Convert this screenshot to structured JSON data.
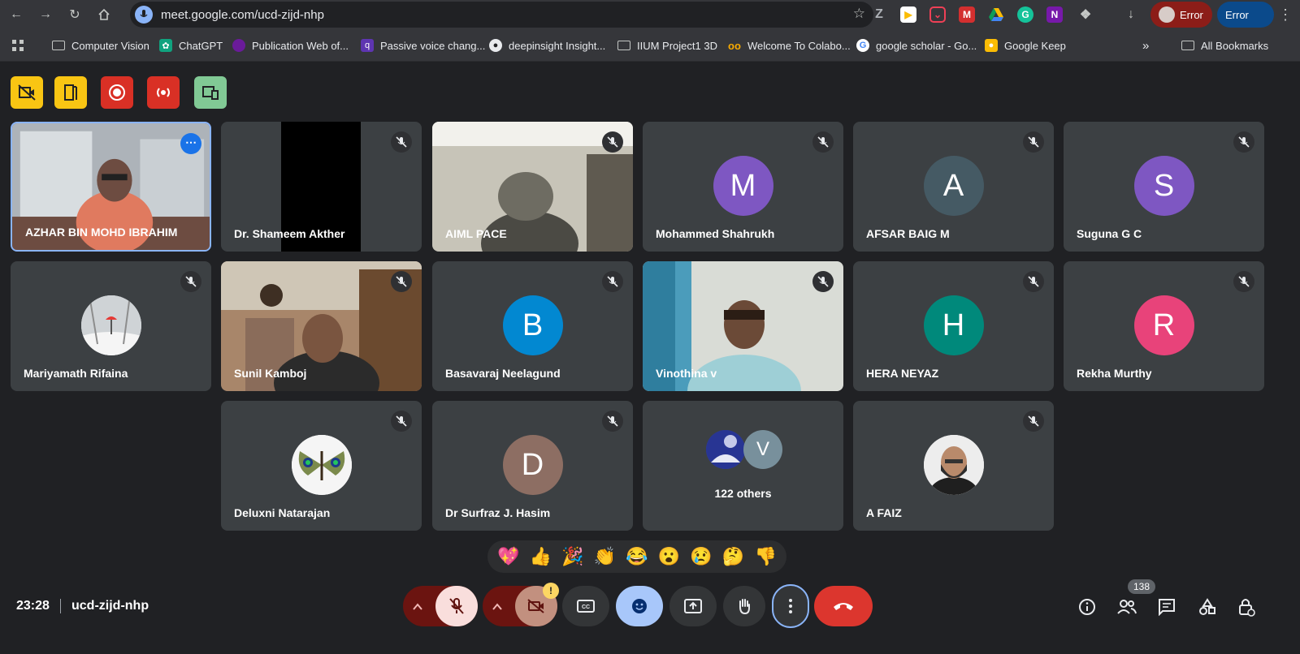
{
  "browser": {
    "url": "meet.google.com/ucd-zijd-nhp",
    "profile_error_1": "Error",
    "profile_error_2": "Error",
    "bookmarks": [
      {
        "label": "Computer Vision",
        "icon": "folder-icon"
      },
      {
        "label": "ChatGPT",
        "icon": "chatgpt-icon"
      },
      {
        "label": "Publication Web of...",
        "icon": "web-icon"
      },
      {
        "label": "Passive voice chang...",
        "icon": "quillbot-icon"
      },
      {
        "label": "deepinsight Insight...",
        "icon": "github-icon"
      },
      {
        "label": "IIUM Project1 3D",
        "icon": "folder-icon"
      },
      {
        "label": "Welcome To Colabo...",
        "icon": "colab-icon"
      },
      {
        "label": "google scholar - Go...",
        "icon": "google-icon"
      },
      {
        "label": "Google Keep",
        "icon": "keep-icon"
      }
    ],
    "all_bookmarks": "All Bookmarks"
  },
  "participants": [
    {
      "name": "AZHAR BIN MOHD IBRAHIM",
      "type": "video"
    },
    {
      "name": "Dr. Shameem Akther",
      "type": "video"
    },
    {
      "name": "AIML PACE",
      "type": "video"
    },
    {
      "name": "Mohammed Shahrukh",
      "type": "avatar",
      "initial": "M",
      "color": "#7e57c2"
    },
    {
      "name": "AFSAR BAIG M",
      "type": "avatar",
      "initial": "A",
      "color": "#455a64"
    },
    {
      "name": "Suguna G C",
      "type": "avatar",
      "initial": "S",
      "color": "#7e57c2"
    },
    {
      "name": "Mariyamath Rifaina",
      "type": "photo"
    },
    {
      "name": "Sunil Kamboj",
      "type": "video"
    },
    {
      "name": "Basavaraj Neelagund",
      "type": "avatar",
      "initial": "B",
      "color": "#0288d1"
    },
    {
      "name": "Vinothina v",
      "type": "video"
    },
    {
      "name": "HERA NEYAZ",
      "type": "avatar",
      "initial": "H",
      "color": "#00897b"
    },
    {
      "name": "Rekha Murthy",
      "type": "avatar",
      "initial": "R",
      "color": "#e8437a"
    },
    {
      "name": "Deluxni Natarajan",
      "type": "photo"
    },
    {
      "name": "Dr Surfraz J. Hasim",
      "type": "avatar",
      "initial": "D",
      "color": "#8d6e63"
    },
    {
      "name": "A FAIZ",
      "type": "photo"
    }
  ],
  "others": {
    "label": "122 others",
    "initial": "V",
    "color": "#78909c"
  },
  "reactions": [
    "💖",
    "👍",
    "🎉",
    "👏",
    "😂",
    "😮",
    "😢",
    "🤔",
    "👎"
  ],
  "bottom": {
    "time": "23:28",
    "meeting_code": "ucd-zijd-nhp",
    "participant_count": "138",
    "camera_warning": "!"
  }
}
